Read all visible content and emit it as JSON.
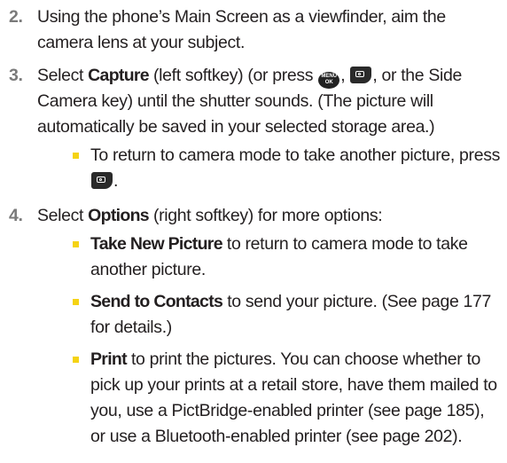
{
  "steps": [
    {
      "number": "2.",
      "text": "Using the phone’s Main Screen as a viewfinder, aim the camera lens at your subject."
    },
    {
      "number": "3.",
      "prefix": "Select ",
      "bold": "Capture",
      "middle": " (left softkey) (or press ",
      "sep1": ", ",
      "after_icons": ", or the Side Camera key) until the shutter sounds. (The picture will automatically be saved in your selected storage area.)",
      "bullets": [
        {
          "text": "To return to camera mode to take another picture, press ",
          "end": "."
        }
      ]
    },
    {
      "number": "4.",
      "prefix": "Select ",
      "bold": "Options",
      "rest": " (right softkey) for more options:",
      "bullets": [
        {
          "bold": "Take New Picture",
          "text": " to return to camera mode to take another picture."
        },
        {
          "bold": "Send to Contacts",
          "text": " to send your picture. (See page 177 for details.)"
        },
        {
          "bold": "Print",
          "text": " to print the pictures. You can choose whether to pick up your prints at a retail store, have them mailed to you, use a PictBridge-enabled printer (see page 185), or use a Bluetooth-enabled printer (see page 202)."
        }
      ]
    }
  ],
  "icons": {
    "menu_key": "menu-ok-key-icon",
    "menu_key_label_top": "MENU",
    "menu_key_label_bottom": "OK",
    "camera_key": "camera-key-icon",
    "bullet_color": "#f5d314",
    "step_number_color": "#7a7a7a"
  }
}
